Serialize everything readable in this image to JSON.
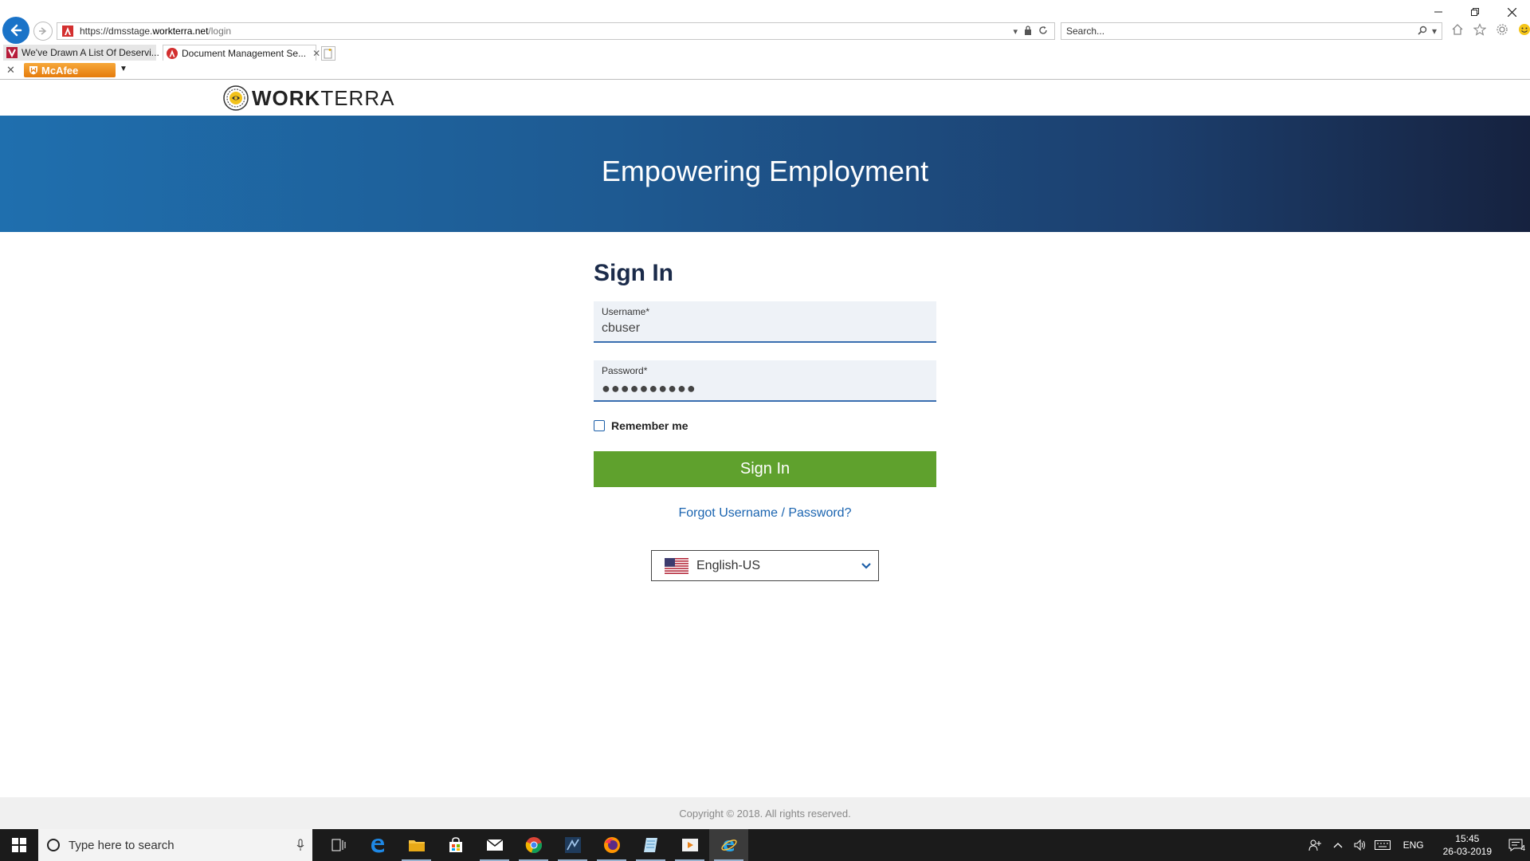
{
  "browser": {
    "url_prefix": "https://dmsstage.",
    "url_domain": "workterra.net",
    "url_path": "/login",
    "search_placeholder": "Search...",
    "tabs": [
      {
        "title": "We've Drawn A List Of Deservi..."
      },
      {
        "title": "Document Management Se..."
      }
    ],
    "toolbar_name": "McAfee"
  },
  "header": {
    "logo_bold": "WORK",
    "logo_light": "TERRA"
  },
  "hero": {
    "title": "Empowering Employment"
  },
  "signin": {
    "title": "Sign In",
    "username_label": "Username*",
    "username_value": "cbuser",
    "password_label": "Password*",
    "password_value": "●●●●●●●●●●",
    "remember_label": "Remember me",
    "button_label": "Sign In",
    "forgot_label": "Forgot Username / Password?",
    "language": "English-US"
  },
  "footer": {
    "copyright": "Copyright © 2018. All rights reserved."
  },
  "taskbar": {
    "search_placeholder": "Type here to search",
    "language": "ENG",
    "time": "15:45",
    "date": "26-03-2019",
    "notification_count": "4"
  },
  "colors": {
    "accent_green": "#5fa12d",
    "link_blue": "#1a64b0",
    "hero_start": "#1f6fae",
    "hero_end": "#16223f"
  }
}
